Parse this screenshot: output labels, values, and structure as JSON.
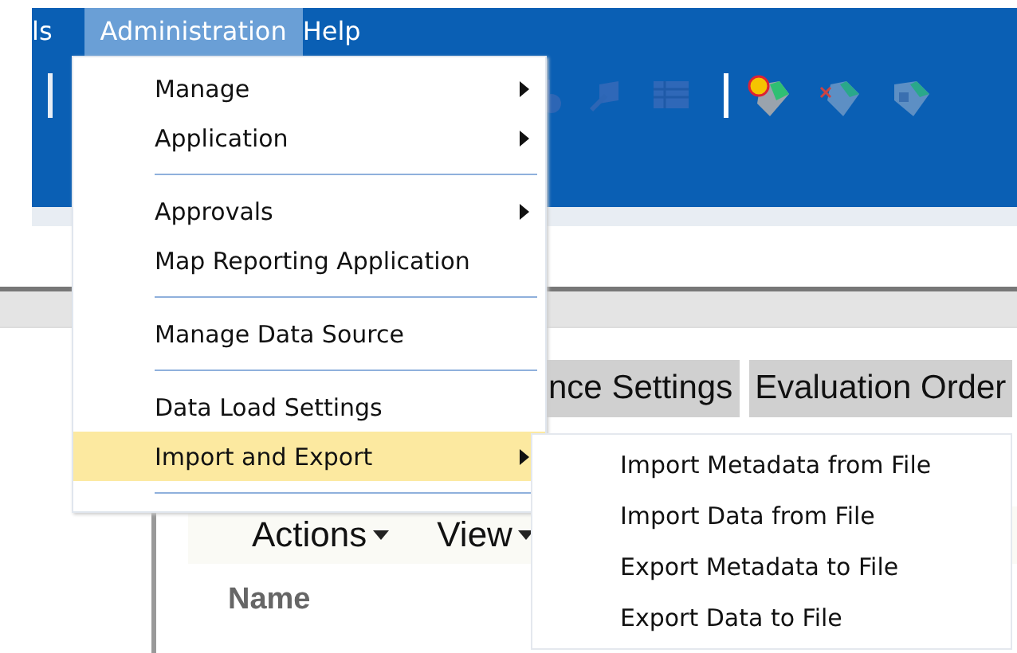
{
  "menubar": [
    {
      "label": "ls",
      "selected": false
    },
    {
      "label": "Administration",
      "selected": true
    },
    {
      "label": "Help",
      "selected": false
    }
  ],
  "menu": {
    "items": [
      {
        "kind": "item",
        "label": "Manage",
        "submenu": true,
        "selected": false
      },
      {
        "kind": "item",
        "label": "Application",
        "submenu": true,
        "selected": false
      },
      {
        "kind": "separator"
      },
      {
        "kind": "item",
        "label": "Approvals",
        "submenu": true,
        "selected": false
      },
      {
        "kind": "item",
        "label": "Map Reporting Application",
        "submenu": false,
        "selected": false
      },
      {
        "kind": "separator"
      },
      {
        "kind": "item",
        "label": "Manage Data Source",
        "submenu": false,
        "selected": false
      },
      {
        "kind": "separator"
      },
      {
        "kind": "item",
        "label": "Data Load Settings",
        "submenu": false,
        "selected": false
      },
      {
        "kind": "item",
        "label": "Import and Export",
        "submenu": true,
        "selected": true
      },
      {
        "kind": "separator"
      }
    ]
  },
  "submenu": {
    "items": [
      {
        "label": "Import Metadata from File"
      },
      {
        "label": "Import Data from File"
      },
      {
        "label": "Export Metadata to File"
      },
      {
        "label": "Export Data to File"
      }
    ]
  },
  "tabs": [
    {
      "label": "nce Settings"
    },
    {
      "label": "Evaluation Order"
    }
  ],
  "actions": [
    {
      "label": "Actions"
    },
    {
      "label": "View"
    }
  ],
  "table": {
    "columns": [
      "Name"
    ]
  }
}
